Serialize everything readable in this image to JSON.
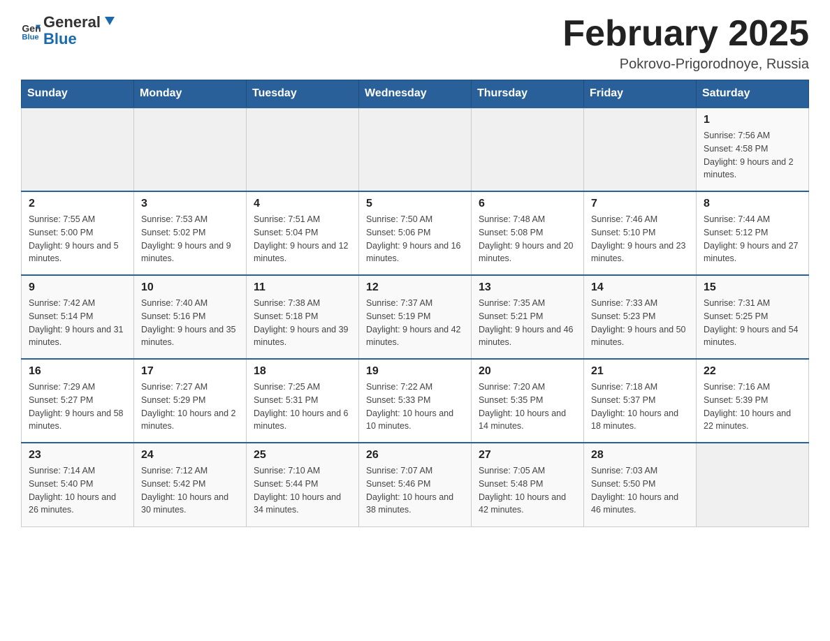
{
  "header": {
    "logo_general": "General",
    "logo_blue": "Blue",
    "month_title": "February 2025",
    "location": "Pokrovo-Prigorodnoye, Russia"
  },
  "weekdays": [
    "Sunday",
    "Monday",
    "Tuesday",
    "Wednesday",
    "Thursday",
    "Friday",
    "Saturday"
  ],
  "weeks": [
    [
      {
        "day": "",
        "sunrise": "",
        "sunset": "",
        "daylight": ""
      },
      {
        "day": "",
        "sunrise": "",
        "sunset": "",
        "daylight": ""
      },
      {
        "day": "",
        "sunrise": "",
        "sunset": "",
        "daylight": ""
      },
      {
        "day": "",
        "sunrise": "",
        "sunset": "",
        "daylight": ""
      },
      {
        "day": "",
        "sunrise": "",
        "sunset": "",
        "daylight": ""
      },
      {
        "day": "",
        "sunrise": "",
        "sunset": "",
        "daylight": ""
      },
      {
        "day": "1",
        "sunrise": "Sunrise: 7:56 AM",
        "sunset": "Sunset: 4:58 PM",
        "daylight": "Daylight: 9 hours and 2 minutes."
      }
    ],
    [
      {
        "day": "2",
        "sunrise": "Sunrise: 7:55 AM",
        "sunset": "Sunset: 5:00 PM",
        "daylight": "Daylight: 9 hours and 5 minutes."
      },
      {
        "day": "3",
        "sunrise": "Sunrise: 7:53 AM",
        "sunset": "Sunset: 5:02 PM",
        "daylight": "Daylight: 9 hours and 9 minutes."
      },
      {
        "day": "4",
        "sunrise": "Sunrise: 7:51 AM",
        "sunset": "Sunset: 5:04 PM",
        "daylight": "Daylight: 9 hours and 12 minutes."
      },
      {
        "day": "5",
        "sunrise": "Sunrise: 7:50 AM",
        "sunset": "Sunset: 5:06 PM",
        "daylight": "Daylight: 9 hours and 16 minutes."
      },
      {
        "day": "6",
        "sunrise": "Sunrise: 7:48 AM",
        "sunset": "Sunset: 5:08 PM",
        "daylight": "Daylight: 9 hours and 20 minutes."
      },
      {
        "day": "7",
        "sunrise": "Sunrise: 7:46 AM",
        "sunset": "Sunset: 5:10 PM",
        "daylight": "Daylight: 9 hours and 23 minutes."
      },
      {
        "day": "8",
        "sunrise": "Sunrise: 7:44 AM",
        "sunset": "Sunset: 5:12 PM",
        "daylight": "Daylight: 9 hours and 27 minutes."
      }
    ],
    [
      {
        "day": "9",
        "sunrise": "Sunrise: 7:42 AM",
        "sunset": "Sunset: 5:14 PM",
        "daylight": "Daylight: 9 hours and 31 minutes."
      },
      {
        "day": "10",
        "sunrise": "Sunrise: 7:40 AM",
        "sunset": "Sunset: 5:16 PM",
        "daylight": "Daylight: 9 hours and 35 minutes."
      },
      {
        "day": "11",
        "sunrise": "Sunrise: 7:38 AM",
        "sunset": "Sunset: 5:18 PM",
        "daylight": "Daylight: 9 hours and 39 minutes."
      },
      {
        "day": "12",
        "sunrise": "Sunrise: 7:37 AM",
        "sunset": "Sunset: 5:19 PM",
        "daylight": "Daylight: 9 hours and 42 minutes."
      },
      {
        "day": "13",
        "sunrise": "Sunrise: 7:35 AM",
        "sunset": "Sunset: 5:21 PM",
        "daylight": "Daylight: 9 hours and 46 minutes."
      },
      {
        "day": "14",
        "sunrise": "Sunrise: 7:33 AM",
        "sunset": "Sunset: 5:23 PM",
        "daylight": "Daylight: 9 hours and 50 minutes."
      },
      {
        "day": "15",
        "sunrise": "Sunrise: 7:31 AM",
        "sunset": "Sunset: 5:25 PM",
        "daylight": "Daylight: 9 hours and 54 minutes."
      }
    ],
    [
      {
        "day": "16",
        "sunrise": "Sunrise: 7:29 AM",
        "sunset": "Sunset: 5:27 PM",
        "daylight": "Daylight: 9 hours and 58 minutes."
      },
      {
        "day": "17",
        "sunrise": "Sunrise: 7:27 AM",
        "sunset": "Sunset: 5:29 PM",
        "daylight": "Daylight: 10 hours and 2 minutes."
      },
      {
        "day": "18",
        "sunrise": "Sunrise: 7:25 AM",
        "sunset": "Sunset: 5:31 PM",
        "daylight": "Daylight: 10 hours and 6 minutes."
      },
      {
        "day": "19",
        "sunrise": "Sunrise: 7:22 AM",
        "sunset": "Sunset: 5:33 PM",
        "daylight": "Daylight: 10 hours and 10 minutes."
      },
      {
        "day": "20",
        "sunrise": "Sunrise: 7:20 AM",
        "sunset": "Sunset: 5:35 PM",
        "daylight": "Daylight: 10 hours and 14 minutes."
      },
      {
        "day": "21",
        "sunrise": "Sunrise: 7:18 AM",
        "sunset": "Sunset: 5:37 PM",
        "daylight": "Daylight: 10 hours and 18 minutes."
      },
      {
        "day": "22",
        "sunrise": "Sunrise: 7:16 AM",
        "sunset": "Sunset: 5:39 PM",
        "daylight": "Daylight: 10 hours and 22 minutes."
      }
    ],
    [
      {
        "day": "23",
        "sunrise": "Sunrise: 7:14 AM",
        "sunset": "Sunset: 5:40 PM",
        "daylight": "Daylight: 10 hours and 26 minutes."
      },
      {
        "day": "24",
        "sunrise": "Sunrise: 7:12 AM",
        "sunset": "Sunset: 5:42 PM",
        "daylight": "Daylight: 10 hours and 30 minutes."
      },
      {
        "day": "25",
        "sunrise": "Sunrise: 7:10 AM",
        "sunset": "Sunset: 5:44 PM",
        "daylight": "Daylight: 10 hours and 34 minutes."
      },
      {
        "day": "26",
        "sunrise": "Sunrise: 7:07 AM",
        "sunset": "Sunset: 5:46 PM",
        "daylight": "Daylight: 10 hours and 38 minutes."
      },
      {
        "day": "27",
        "sunrise": "Sunrise: 7:05 AM",
        "sunset": "Sunset: 5:48 PM",
        "daylight": "Daylight: 10 hours and 42 minutes."
      },
      {
        "day": "28",
        "sunrise": "Sunrise: 7:03 AM",
        "sunset": "Sunset: 5:50 PM",
        "daylight": "Daylight: 10 hours and 46 minutes."
      },
      {
        "day": "",
        "sunrise": "",
        "sunset": "",
        "daylight": ""
      }
    ]
  ]
}
